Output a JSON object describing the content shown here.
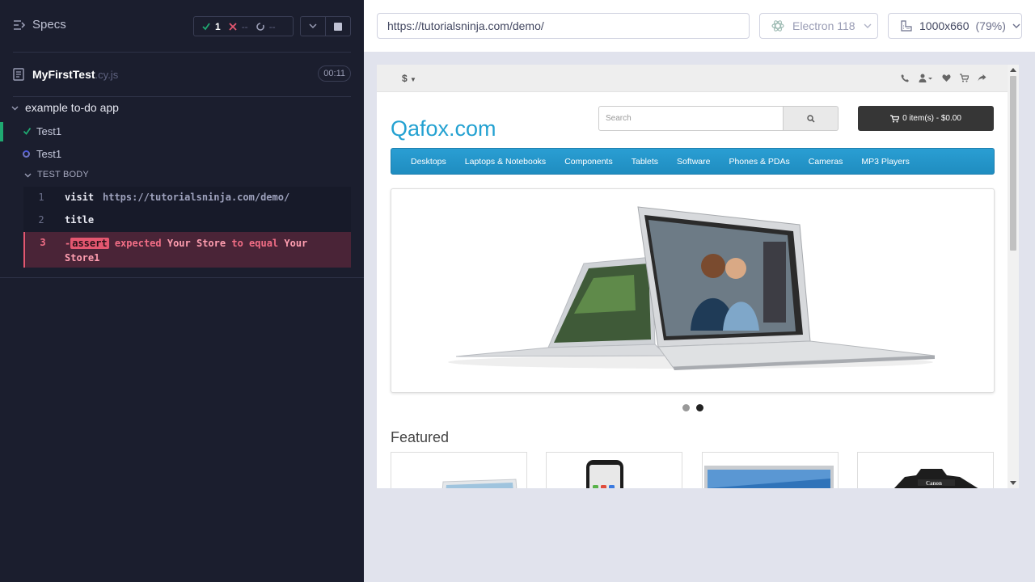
{
  "reporter": {
    "specs_label": "Specs",
    "stats": {
      "passed": "1",
      "failed": "--",
      "pending": "--"
    },
    "spec": {
      "name": "MyFirstTest",
      "ext": ".cy.js",
      "duration": "00:11"
    },
    "suite": "example to-do app",
    "tests": [
      {
        "label": "Test1",
        "state": "passed"
      },
      {
        "label": "Test1",
        "state": "running"
      }
    ],
    "test_body_label": "TEST BODY",
    "commands": [
      {
        "num": "1",
        "name": "visit",
        "arg": "https://tutorialsninja.com/demo/"
      },
      {
        "num": "2",
        "name": "title",
        "arg": ""
      },
      {
        "num": "3",
        "prefix": "-",
        "name": "assert",
        "msg_a": "expected",
        "val_a": "Your Store",
        "msg_b": "to equal",
        "val_b": "Your Store1"
      }
    ]
  },
  "aut": {
    "url": "https://tutorialsninja.com/demo/",
    "browser": "Electron 118",
    "viewport": "1000x660",
    "zoom": "(79%)"
  },
  "site": {
    "currency": "$",
    "logo": "Qafox.com",
    "search_placeholder": "Search",
    "cart": "0 item(s) - $0.00",
    "menu": [
      "Desktops",
      "Laptops & Notebooks",
      "Components",
      "Tablets",
      "Software",
      "Phones & PDAs",
      "Cameras",
      "MP3 Players"
    ],
    "featured_heading": "Featured"
  },
  "colors": {
    "reporter_bg": "#1b1e2e",
    "pass": "#1fa971",
    "fail": "#e45770",
    "site_accent": "#23a1d1"
  }
}
